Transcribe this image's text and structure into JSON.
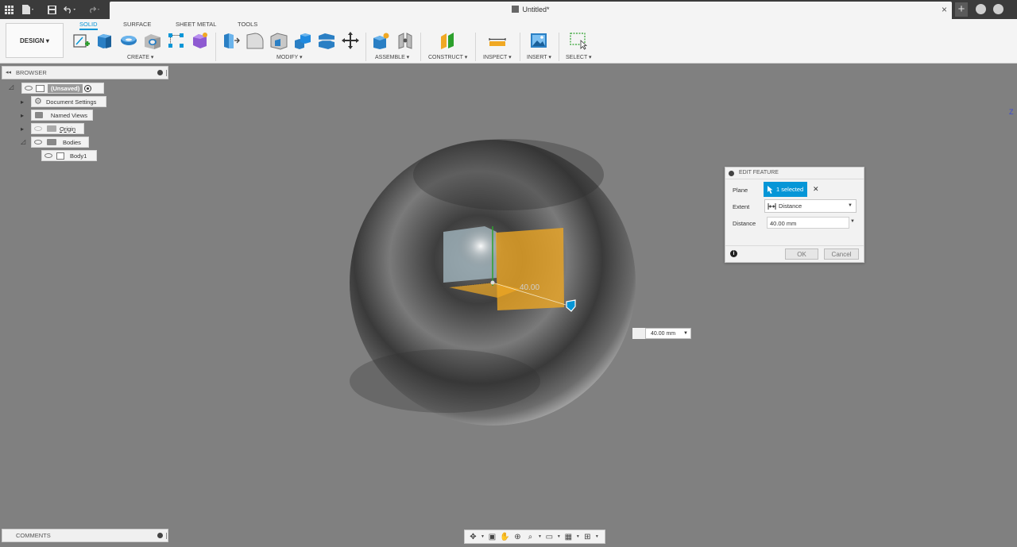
{
  "app": {
    "tab_title": "Untitled*",
    "tab_close": "×",
    "new_tab": "+"
  },
  "toolbar": {
    "workspace": "DESIGN ▾",
    "tabs": [
      "SOLID",
      "SURFACE",
      "SHEET METAL",
      "TOOLS"
    ],
    "groups": {
      "create": "CREATE ▾",
      "modify": "MODIFY ▾",
      "assemble": "ASSEMBLE ▾",
      "construct": "CONSTRUCT ▾",
      "inspect": "INSPECT ▾",
      "insert": "INSERT ▾",
      "select": "SELECT ▾"
    }
  },
  "browser": {
    "title": "BROWSER",
    "root": "(Unsaved)",
    "items": [
      "Document Settings",
      "Named Views",
      "Origin",
      "Bodies",
      "Body1"
    ]
  },
  "dialog": {
    "title": "EDIT FEATURE",
    "plane_label": "Plane",
    "plane_value": "1 selected",
    "clear": "✕",
    "extent_label": "Extent",
    "extent_value": "Distance",
    "distance_label": "Distance",
    "distance_value": "40.00 mm",
    "ok": "OK",
    "cancel": "Cancel"
  },
  "canvas": {
    "dimension_label": "40.00",
    "distance_input": "40.00 mm",
    "axis_label": "Z"
  },
  "comments": {
    "title": "COMMENTS"
  },
  "colors": {
    "accent": "#0696d7",
    "plane": "#f0a823",
    "background": "#808080"
  }
}
